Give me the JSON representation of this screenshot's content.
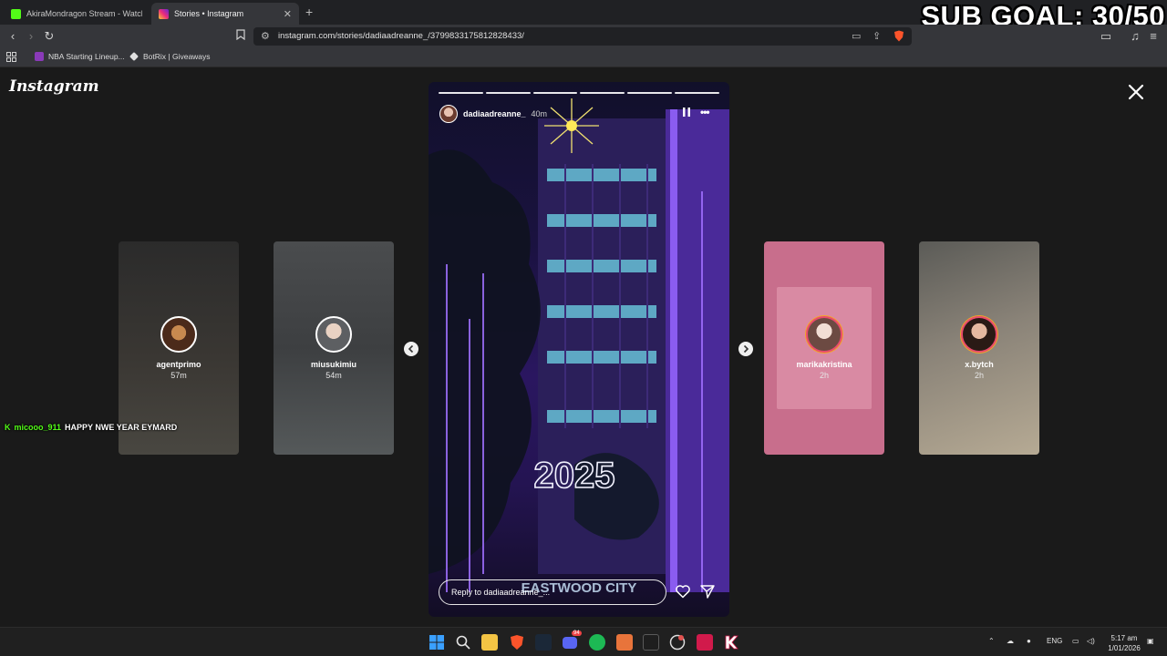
{
  "overlay": {
    "sub_goal": "SUB GOAL: 30/50"
  },
  "browser": {
    "tabs": [
      {
        "title": "AkiraMondragon Stream - Watch Live",
        "active": false
      },
      {
        "title": "Stories • Instagram",
        "active": true
      }
    ],
    "url": "instagram.com/stories/dadiaadreanne_/3799833175812828433/",
    "bookmarks": [
      "NBA Starting Lineup...",
      "BotRix | Giveaways"
    ]
  },
  "instagram": {
    "logo": "Instagram",
    "current_story": {
      "username": "dadiaadreanne_",
      "time": "40m",
      "reply_placeholder": "Reply to dadiaadreanne_...",
      "progress_segments": 6,
      "scene_text": "2025",
      "scene_sign": "EASTWOOD CITY"
    },
    "previews": [
      {
        "username": "agentprimo",
        "time": "57m"
      },
      {
        "username": "miusukimiu",
        "time": "54m"
      },
      {
        "username": "marikakristina",
        "time": "2h"
      },
      {
        "username": "x.bytch",
        "time": "2h"
      }
    ]
  },
  "chat_overlay": {
    "user": "micooo_911",
    "message": "HAPPY NWE YEAR EYMARD"
  },
  "taskbar": {
    "language": "ENG",
    "time": "5:17 am",
    "date": "1/01/2026",
    "discord_badge": "94"
  },
  "colors": {
    "kick_green": "#53fc18",
    "brave_orange": "#fb542b",
    "instagram_pink": "#e94b6b"
  }
}
